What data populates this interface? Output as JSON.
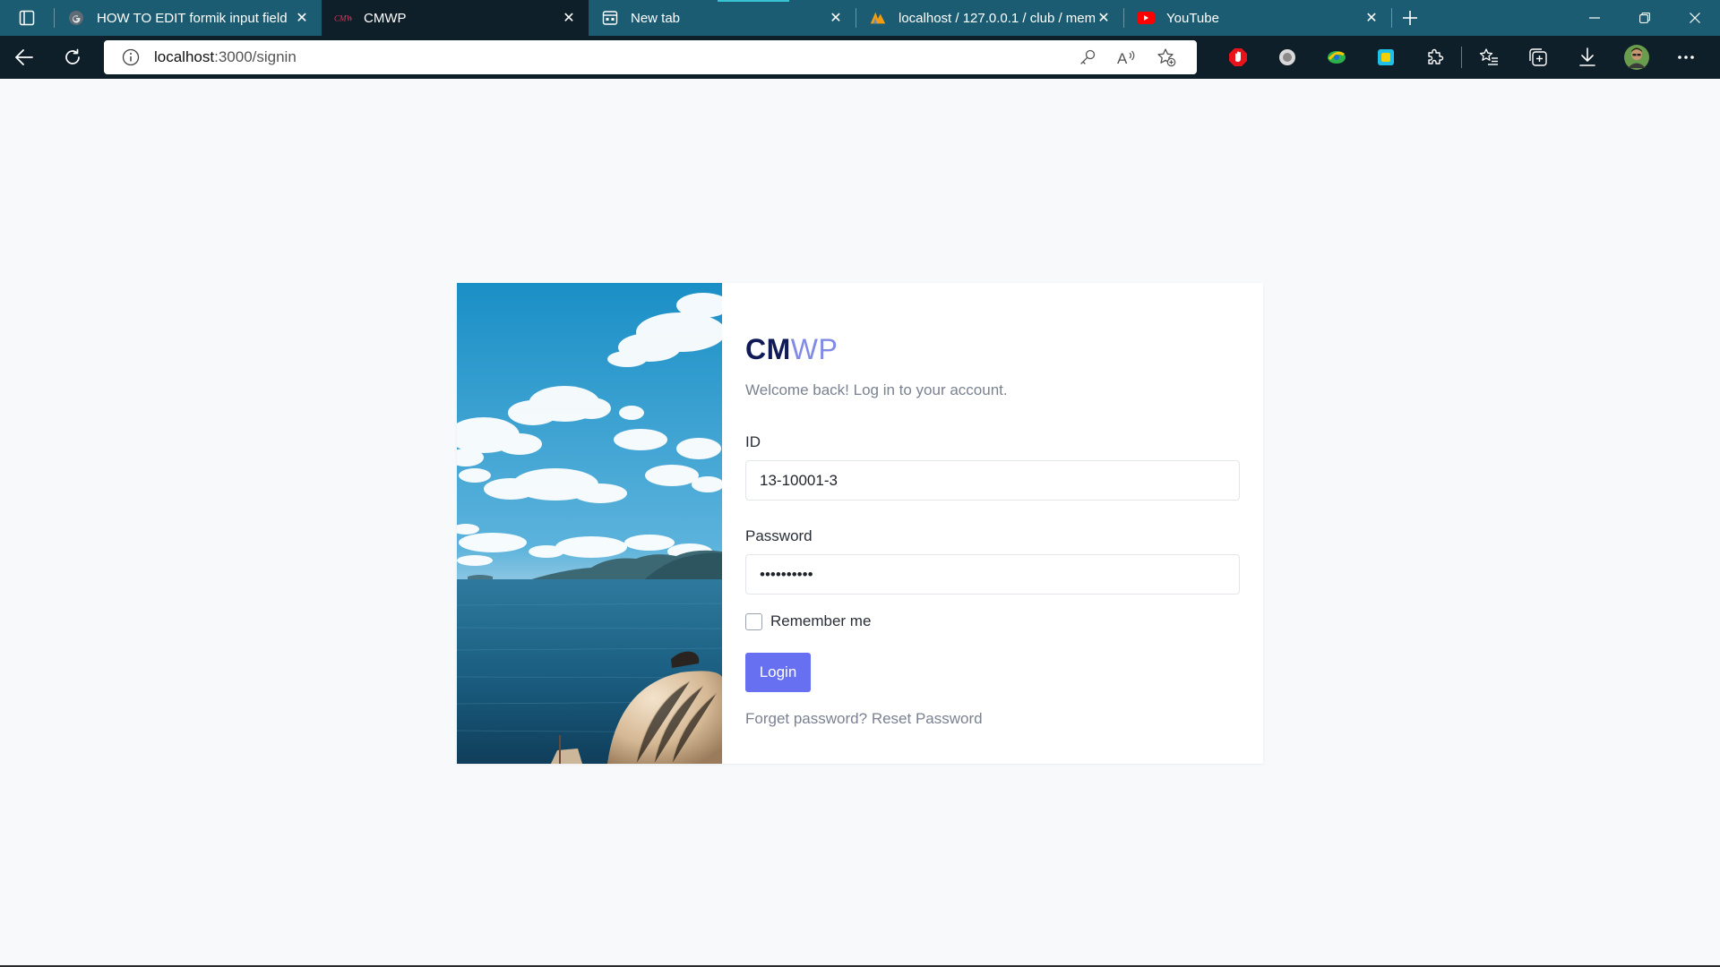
{
  "browser": {
    "tabs": [
      {
        "title": "HOW TO EDIT formik input field",
        "favicon": "google-icon",
        "active": false
      },
      {
        "title": "CMWP",
        "favicon": "cmwp-icon",
        "active": true
      },
      {
        "title": "New tab",
        "favicon": "new-tab-page-icon",
        "active": false
      },
      {
        "title": "localhost / 127.0.0.1 / club / mem",
        "favicon": "phpmyadmin-icon",
        "active": false
      },
      {
        "title": "YouTube",
        "favicon": "youtube-icon",
        "active": false
      }
    ],
    "address": {
      "host": "localhost",
      "path": ":3000/signin"
    }
  },
  "login": {
    "brand_bold": "CM",
    "brand_light": "WP",
    "welcome": "Welcome back! Log in to your account.",
    "id_label": "ID",
    "id_value": "13-10001-3",
    "password_label": "Password",
    "password_value": "••••••••••",
    "remember_label": "Remember me",
    "remember_checked": false,
    "login_button": "Login",
    "forgot_text": "Forget password?",
    "reset_link": "Reset Password"
  },
  "colors": {
    "tabstrip": "#1c5c72",
    "toolbar": "#0f1f2a",
    "brand_dark": "#0f1a57",
    "brand_light": "#7f8be4",
    "button": "#6870f2",
    "page_bg": "#f8f9fb"
  }
}
